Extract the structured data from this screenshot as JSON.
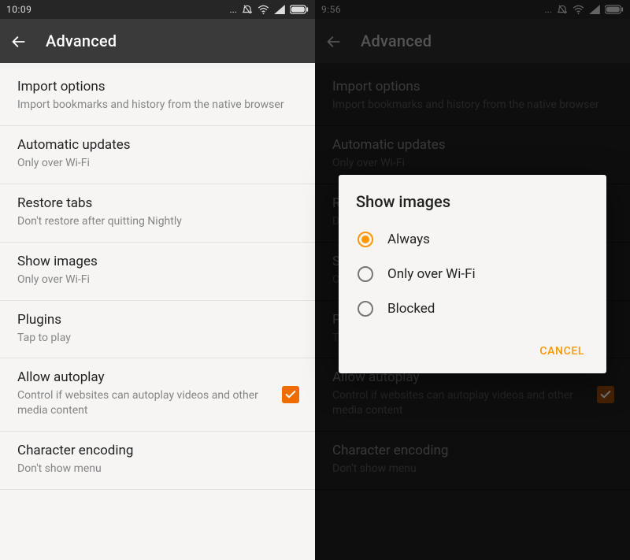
{
  "left": {
    "status_time": "10:09",
    "appbar_title": "Advanced",
    "items": [
      {
        "title": "Import options",
        "subtitle": "Import bookmarks and history from the native browser"
      },
      {
        "title": "Automatic updates",
        "subtitle": "Only over Wi-Fi"
      },
      {
        "title": "Restore tabs",
        "subtitle": "Don't restore after quitting Nightly"
      },
      {
        "title": "Show images",
        "subtitle": "Only over Wi-Fi"
      },
      {
        "title": "Plugins",
        "subtitle": "Tap to play"
      },
      {
        "title": "Allow autoplay",
        "subtitle": "Control if websites can autoplay videos and other media content",
        "checked": true
      },
      {
        "title": "Character encoding",
        "subtitle": "Don't show menu"
      }
    ]
  },
  "right": {
    "status_time": "9:56",
    "appbar_title": "Advanced",
    "items": [
      {
        "title": "Import options",
        "subtitle": "Import bookmarks and history from the native browser"
      },
      {
        "title": "Automatic updates",
        "subtitle": "Only over Wi-Fi"
      },
      {
        "title": "Restore tabs",
        "subtitle": "Don't restore after quitting Nightly"
      },
      {
        "title": "Show images",
        "subtitle": "Only over Wi-Fi"
      },
      {
        "title": "Plugins",
        "subtitle": "Tap to play"
      },
      {
        "title": "Allow autoplay",
        "subtitle": "Control if websites can autoplay videos and other media content",
        "checked": true
      },
      {
        "title": "Character encoding",
        "subtitle": "Don't show menu"
      }
    ],
    "dialog": {
      "title": "Show images",
      "options": [
        {
          "label": "Always",
          "selected": true
        },
        {
          "label": "Only over Wi-Fi",
          "selected": false
        },
        {
          "label": "Blocked",
          "selected": false
        }
      ],
      "cancel": "CANCEL"
    }
  },
  "status_icons": {
    "dots": "...",
    "alarm": "alarm-off-icon",
    "wifi": "wifi-icon",
    "signal": "signal-icon",
    "battery": "battery-icon"
  }
}
